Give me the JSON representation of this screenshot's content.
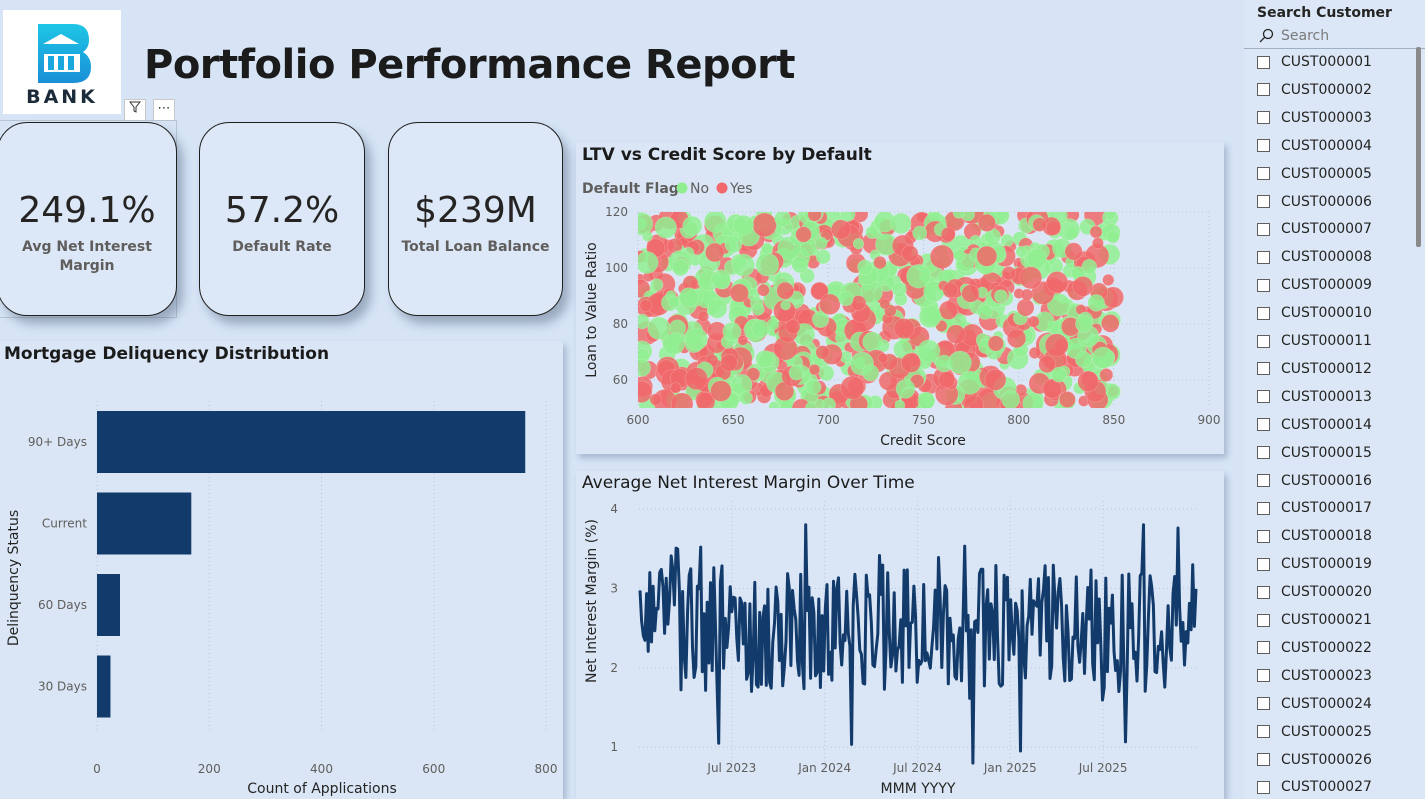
{
  "header": {
    "logo_text": "BANK",
    "title": "Portfolio Performance Report"
  },
  "kpis": [
    {
      "value": "249.1%",
      "label": "Avg Net Interest Margin"
    },
    {
      "value": "57.2%",
      "label": "Default Rate"
    },
    {
      "value": "$239M",
      "label": "Total Loan Balance"
    }
  ],
  "colors": {
    "bar": "#123b6b",
    "no": "#90ee90",
    "yes": "#f0686a",
    "line": "#123b6b"
  },
  "icons": [
    "filter-icon",
    "more-options-icon",
    "search-icon"
  ],
  "slicer": {
    "title": "Search Customer",
    "search_placeholder": "Search",
    "items": [
      "CUST000001",
      "CUST000002",
      "CUST000003",
      "CUST000004",
      "CUST000005",
      "CUST000006",
      "CUST000007",
      "CUST000008",
      "CUST000009",
      "CUST000010",
      "CUST000011",
      "CUST000012",
      "CUST000013",
      "CUST000014",
      "CUST000015",
      "CUST000016",
      "CUST000017",
      "CUST000018",
      "CUST000019",
      "CUST000020",
      "CUST000021",
      "CUST000022",
      "CUST000023",
      "CUST000024",
      "CUST000025",
      "CUST000026",
      "CUST000027"
    ]
  },
  "chart_data": [
    {
      "id": "delinquency",
      "type": "bar",
      "orientation": "horizontal",
      "title": "Mortgage Deliquency Distribution",
      "xlabel": "Count of Applications",
      "ylabel": "Delinquency Status",
      "categories": [
        "90+ Days",
        "Current",
        "60 Days",
        "30 Days"
      ],
      "values": [
        763,
        168,
        41,
        24
      ],
      "xlim": [
        0,
        800
      ],
      "xticks": [
        "0",
        "200",
        "400",
        "600",
        "800"
      ],
      "grid": true
    },
    {
      "id": "ltv_scatter",
      "type": "scatter",
      "title": "LTV vs Credit Score by Default",
      "legend_title": "Default Flag",
      "legend": [
        "No",
        "Yes"
      ],
      "legend_position": "top-left",
      "xlabel": "Credit Score",
      "ylabel": "Loan to Value Ratio",
      "xlim": [
        600,
        900
      ],
      "ylim": [
        50,
        120
      ],
      "xticks": [
        "600",
        "650",
        "700",
        "750",
        "800",
        "850",
        "900"
      ],
      "yticks": [
        "60",
        "80",
        "100",
        "120"
      ],
      "point_x_range": [
        600,
        850
      ],
      "point_y_range": [
        50,
        120
      ],
      "points_per_series": 450,
      "grid": true
    },
    {
      "id": "nim_line",
      "type": "line",
      "title": "Average Net Interest Margin Over Time",
      "xlabel": "MMM YYYY",
      "ylabel": "Net Interest Margin (%)",
      "ylim": [
        0.7,
        4.1
      ],
      "x_start": "Jan 2023",
      "x_end": "Dec 2025",
      "xticks": [
        "Jul 2023",
        "Jan 2024",
        "Jul 2024",
        "Jan 2025",
        "Jul 2025"
      ],
      "yticks": [
        "1",
        "2",
        "3",
        "4"
      ],
      "value_mean": 2.5,
      "value_min": 0.8,
      "value_max": 3.8,
      "points": 340,
      "grid": true
    }
  ]
}
